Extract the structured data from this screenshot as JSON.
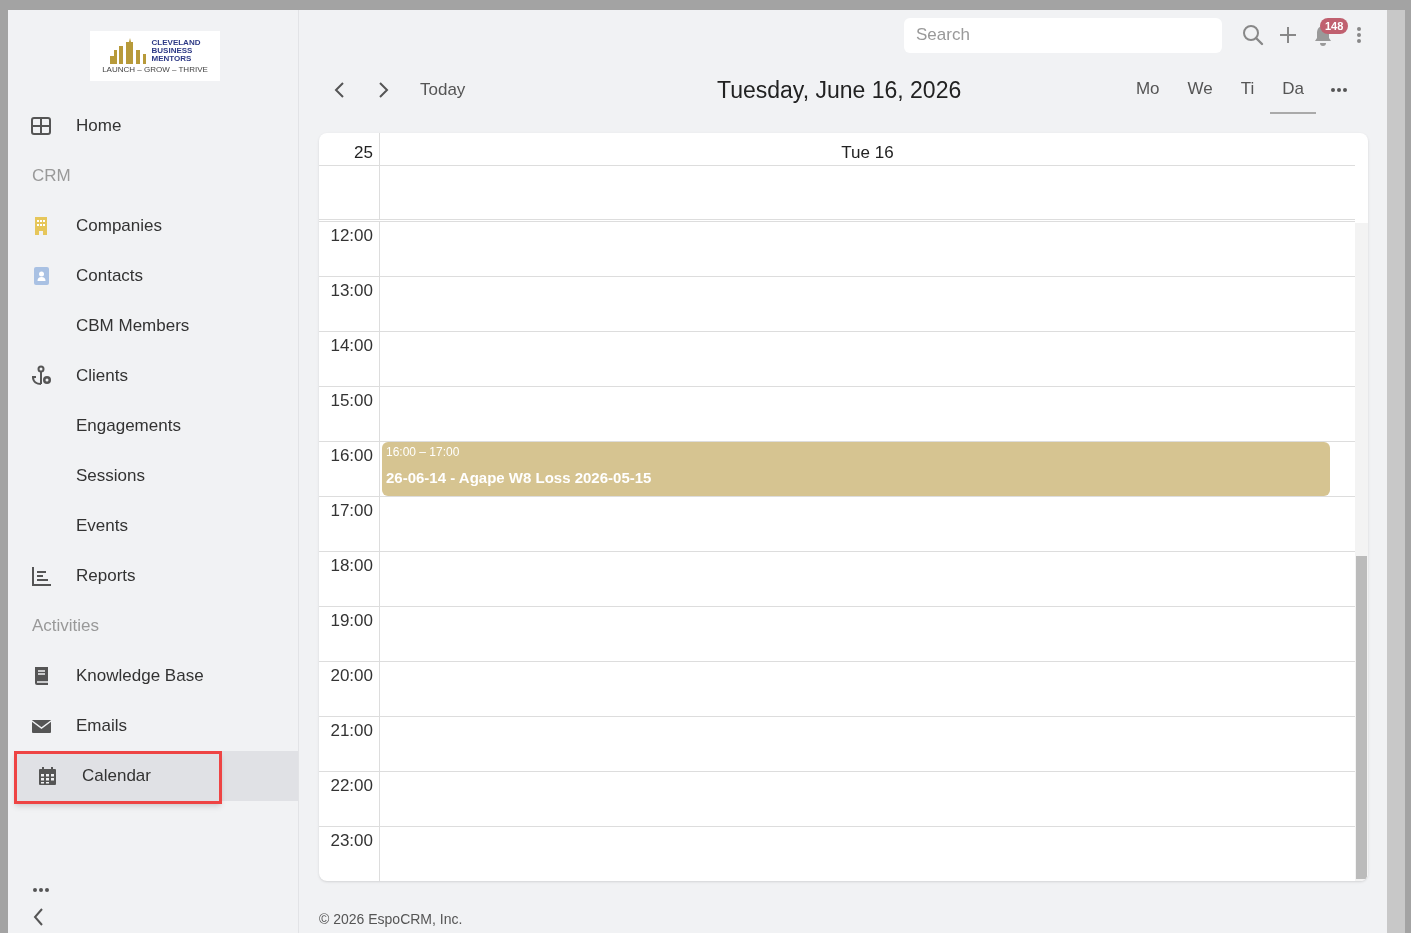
{
  "logo": {
    "lines": [
      "CLEVELAND",
      "BUSINESS",
      "MENTORS"
    ],
    "tagline": "LAUNCH – GROW – THRIVE"
  },
  "sidebar": {
    "items": [
      {
        "kind": "link",
        "label": "Home",
        "selected": false,
        "highlighted": false
      },
      {
        "kind": "section",
        "label": "CRM"
      },
      {
        "kind": "link",
        "label": "Companies",
        "selected": false,
        "highlighted": false
      },
      {
        "kind": "link",
        "label": "Contacts",
        "selected": false,
        "highlighted": false
      },
      {
        "kind": "link",
        "label": "CBM Members",
        "selected": false,
        "highlighted": false
      },
      {
        "kind": "link",
        "label": "Clients",
        "selected": false,
        "highlighted": false
      },
      {
        "kind": "link",
        "label": "Engagements",
        "selected": false,
        "highlighted": false
      },
      {
        "kind": "link",
        "label": "Sessions",
        "selected": false,
        "highlighted": false
      },
      {
        "kind": "link",
        "label": "Events",
        "selected": false,
        "highlighted": false
      },
      {
        "kind": "link",
        "label": "Reports",
        "selected": false,
        "highlighted": false
      },
      {
        "kind": "section",
        "label": "Activities"
      },
      {
        "kind": "link",
        "label": "Knowledge Base",
        "selected": false,
        "highlighted": false
      },
      {
        "kind": "link",
        "label": "Emails",
        "selected": false,
        "highlighted": false
      },
      {
        "kind": "link",
        "label": "Calendar",
        "selected": true,
        "highlighted": true
      }
    ]
  },
  "topbar": {
    "search": {
      "placeholder": "Search"
    },
    "notifications": "148"
  },
  "toolbar": {
    "today": "Today",
    "title": "Tuesday, June 16, 2026",
    "views": [
      {
        "label": "Mo",
        "selected": false
      },
      {
        "label": "We",
        "selected": false
      },
      {
        "label": "Ti",
        "selected": false
      },
      {
        "label": "Da",
        "selected": true
      }
    ]
  },
  "calendar": {
    "week": "25",
    "day": "Tue 16",
    "hours": [
      {
        "label": "12:00"
      },
      {
        "label": "13:00"
      },
      {
        "label": "14:00"
      },
      {
        "label": "15:00"
      },
      {
        "label": "16:00",
        "events": [
          {
            "time": "16:00 – 17:00",
            "title": "26-06-14 - Agape W8 Loss 2026-05-15",
            "color": "#d6c491"
          }
        ]
      },
      {
        "label": "17:00"
      },
      {
        "label": "18:00"
      },
      {
        "label": "19:00"
      },
      {
        "label": "20:00"
      },
      {
        "label": "21:00"
      },
      {
        "label": "22:00"
      },
      {
        "label": "23:00"
      }
    ]
  },
  "footer": "© 2026 EspoCRM, Inc."
}
